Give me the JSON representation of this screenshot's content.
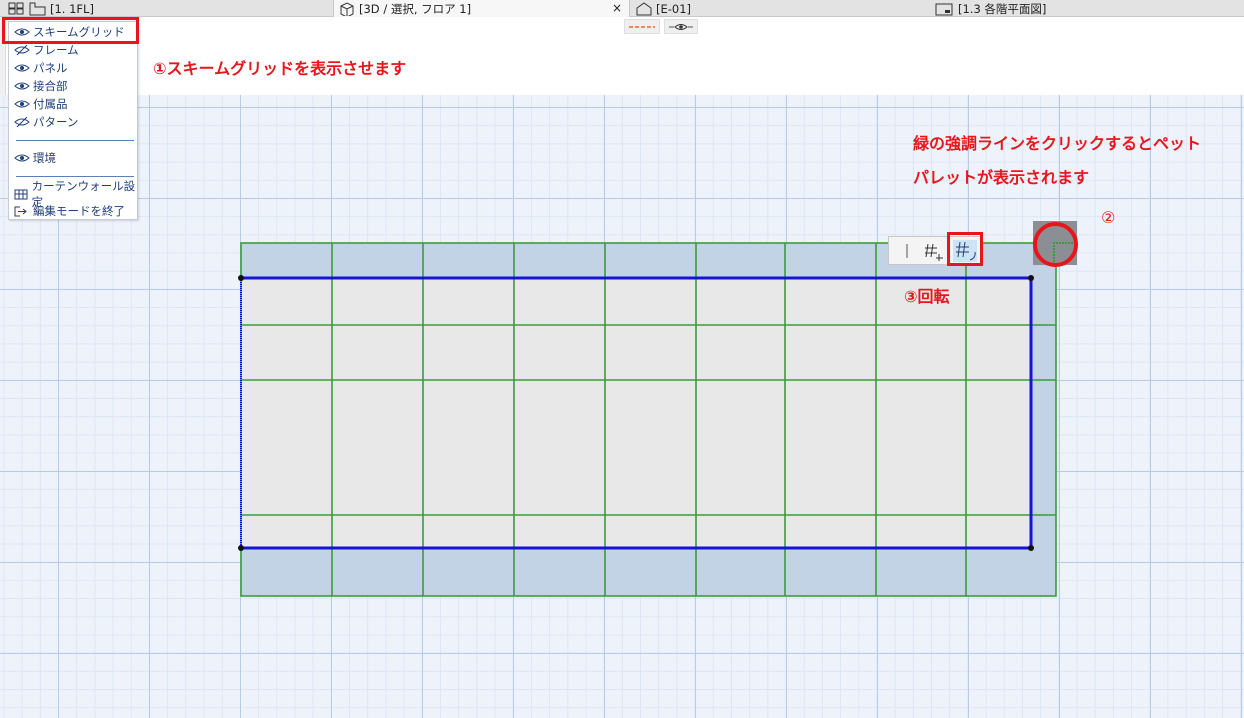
{
  "tabs": [
    {
      "label": "[1. 1FL]",
      "icon": "floor-plan-icon"
    },
    {
      "label": "[3D / 選択, フロア 1]",
      "icon": "3d-box-icon",
      "active": true,
      "close": "×"
    },
    {
      "label": "[E-01]",
      "icon": "elevation-house-icon"
    },
    {
      "label": "[1.3 各階平面図]",
      "icon": "layout-sheet-icon"
    }
  ],
  "menu": {
    "items": [
      {
        "label": "スキームグリッド",
        "icon": "eye-icon"
      },
      {
        "label": "フレーム",
        "icon": "eye-hidden-icon"
      },
      {
        "label": "パネル",
        "icon": "eye-icon"
      },
      {
        "label": "接合部",
        "icon": "eye-icon"
      },
      {
        "label": "付属品",
        "icon": "eye-icon"
      },
      {
        "label": "パターン",
        "icon": "eye-hidden-icon"
      }
    ],
    "environment": {
      "label": "環境",
      "icon": "eye-icon"
    },
    "actions": [
      {
        "label": "カーテンウォール設定",
        "icon": "curtain-wall-settings-icon"
      },
      {
        "label": "編集モードを終了",
        "icon": "exit-edit-mode-icon"
      }
    ]
  },
  "annotations": {
    "step1": "①スキームグリッドを表示させます",
    "step2_line1": "緑の強調ラインをクリックするとペット",
    "step2_line2": "パレットが表示されます",
    "step2_marker": "②",
    "step3": "③回転"
  },
  "colors": {
    "accent_red": "#e8161c",
    "scheme_grid_green": "#3c9a3c",
    "boundary_blue": "#1414d8",
    "panel_fill": "#c3d3e6",
    "inner_fill": "#e8e8e8"
  }
}
